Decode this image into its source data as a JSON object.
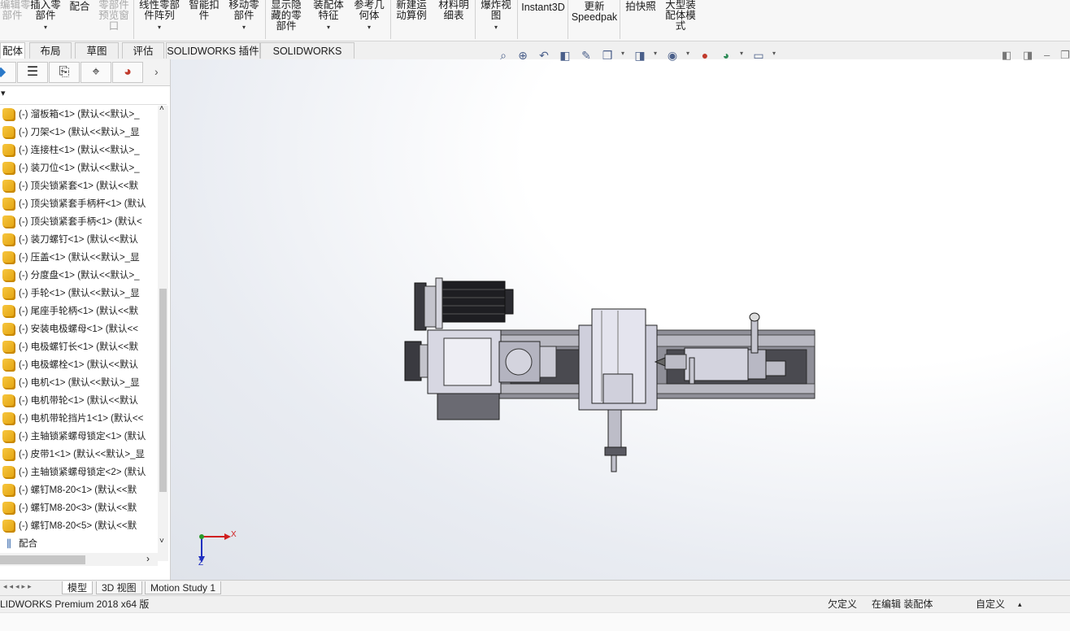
{
  "ribbon": {
    "buttons": [
      {
        "label": "编辑零\n部件",
        "dim": true
      },
      {
        "label": "插入零\n部件",
        "dim": false,
        "arrow": true
      },
      {
        "label": "配合",
        "dim": false
      },
      {
        "label": "零部件\n预览窗\n口",
        "dim": true
      },
      {
        "label": "线性零部\n件阵列",
        "dim": false,
        "arrow": true
      },
      {
        "label": "智能扣\n件",
        "dim": false
      },
      {
        "label": "移动零\n部件",
        "dim": false,
        "arrow": true
      },
      {
        "label": "显示隐\n藏的零\n部件",
        "dim": false
      },
      {
        "label": "装配体\n特征",
        "dim": false,
        "arrow": true
      },
      {
        "label": "参考几\n何体",
        "dim": false,
        "arrow": true
      },
      {
        "label": "新建运\n动算例",
        "dim": false
      },
      {
        "label": "材料明\n细表",
        "dim": false
      },
      {
        "label": "爆炸视\n图",
        "dim": false,
        "arrow": true
      },
      {
        "label": "Instant3D",
        "dim": false
      },
      {
        "label": "更新\nSpeedpak",
        "dim": false
      },
      {
        "label": "拍快照",
        "dim": false
      },
      {
        "label": "大型装\n配体模\n式",
        "dim": false
      }
    ]
  },
  "command_tabs": [
    "配体",
    "布局",
    "草图",
    "评估",
    "SOLIDWORKS 插件",
    "SOLIDWORKS MBD"
  ],
  "heads_up_toolbar": [
    "zoom-to-fit-icon",
    "zoom-to-area-icon",
    "previous-view-icon",
    "section-view-icon",
    "dynamic-annotation-icon",
    "view-orientation-icon",
    "display-style-icon",
    "hide-show-icon",
    "edit-appearance-icon",
    "apply-scene-icon",
    "view-settings-icon"
  ],
  "feature_tree": {
    "items": [
      "(-) 溜板箱<1> (默认<<默认>_",
      "(-) 刀架<1> (默认<<默认>_显",
      "(-) 连接柱<1> (默认<<默认>_",
      "(-) 装刀位<1> (默认<<默认>_",
      "(-) 顶尖锁紧套<1> (默认<<默",
      "(-) 顶尖锁紧套手柄杆<1> (默认",
      "(-) 顶尖锁紧套手柄<1> (默认<",
      "(-) 装刀螺钉<1> (默认<<默认",
      "(-) 压盖<1> (默认<<默认>_显",
      "(-) 分度盘<1> (默认<<默认>_",
      "(-) 手轮<1> (默认<<默认>_显",
      "(-) 尾座手轮柄<1> (默认<<默",
      "(-) 安装电极螺母<1> (默认<<",
      "(-) 电极螺钉长<1> (默认<<默",
      "(-) 电极螺栓<1> (默认<<默认",
      "(-) 电机<1> (默认<<默认>_显",
      "(-) 电机带轮<1> (默认<<默认",
      "(-) 电机带轮挡片1<1> (默认<<",
      "(-) 主轴锁紧螺母锁定<1> (默认",
      "(-) 皮带1<1> (默认<<默认>_显",
      "(-) 主轴锁紧螺母锁定<2> (默认",
      "(-) 螺钉M8-20<1> (默认<<默",
      "(-) 螺钉M8-20<3> (默认<<默",
      "(-) 螺钉M8-20<5> (默认<<默"
    ],
    "mates_label": "配合"
  },
  "bottom_tabs": [
    "模型",
    "3D 视图",
    "Motion Study 1"
  ],
  "status": {
    "product": "LIDWORKS Premium 2018 x64 版",
    "under_defined": "欠定义",
    "editing": "在编辑 装配体",
    "custom": "自定义"
  },
  "triad": {
    "x_label": "X",
    "z_label": "Z"
  },
  "colors": {
    "accent": "#2a5ea8",
    "viewport": "#e9ecf2"
  }
}
